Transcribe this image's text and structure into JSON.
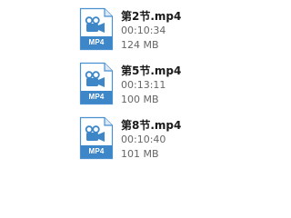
{
  "files": [
    {
      "name": "第2节.mp4",
      "duration": "00:10:34",
      "size": "124 MB",
      "ext_label": "MP4",
      "icon": "video-file-icon"
    },
    {
      "name": "第5节.mp4",
      "duration": "00:13:11",
      "size": "100 MB",
      "ext_label": "MP4",
      "icon": "video-file-icon"
    },
    {
      "name": "第8节.mp4",
      "duration": "00:10:40",
      "size": "101 MB",
      "ext_label": "MP4",
      "icon": "video-file-icon"
    }
  ],
  "colors": {
    "icon_blue": "#3d87c9",
    "icon_page": "#ffffff",
    "icon_border": "#4a8fcf",
    "name_text": "#1a1a1a",
    "meta_text": "#666666"
  }
}
